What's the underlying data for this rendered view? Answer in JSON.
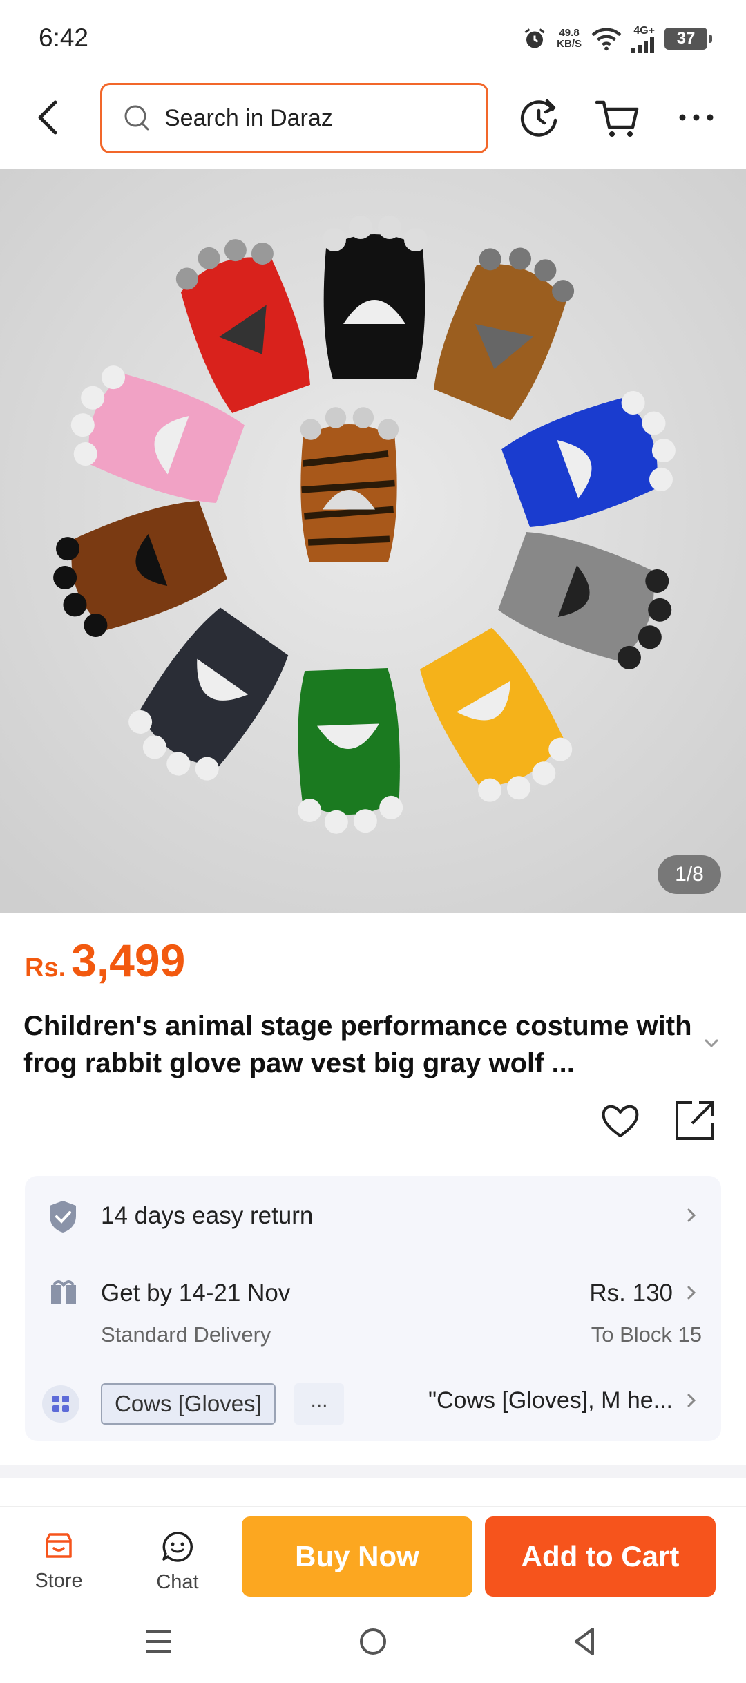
{
  "status_bar": {
    "time": "6:42",
    "speed_value": "49.8",
    "speed_unit": "KB/S",
    "network": "4G+",
    "battery": "37"
  },
  "header": {
    "search_placeholder": "Search in Daraz"
  },
  "gallery": {
    "counter": "1/8"
  },
  "product": {
    "currency": "Rs.",
    "price": "3,499",
    "title": "Children's animal stage performance costume with frog rabbit glove paw vest big gray wolf ..."
  },
  "info": {
    "return_text": "14 days easy return",
    "delivery_text": "Get by 14-21 Nov",
    "delivery_type": "Standard Delivery",
    "delivery_fee": "Rs. 130",
    "delivery_location": "To Block 15",
    "variant_chip": "Cows [Gloves]",
    "variant_more": "...",
    "variant_selected": "\"Cows [Gloves], M he..."
  },
  "bottom_bar": {
    "store_label": "Store",
    "chat_label": "Chat",
    "buy_now_label": "Buy Now",
    "add_to_cart_label": "Add to Cart"
  },
  "colors": {
    "accent": "#f6541c",
    "price": "#f2590f",
    "buy_now": "#fca720",
    "search_border": "#f2672a"
  }
}
